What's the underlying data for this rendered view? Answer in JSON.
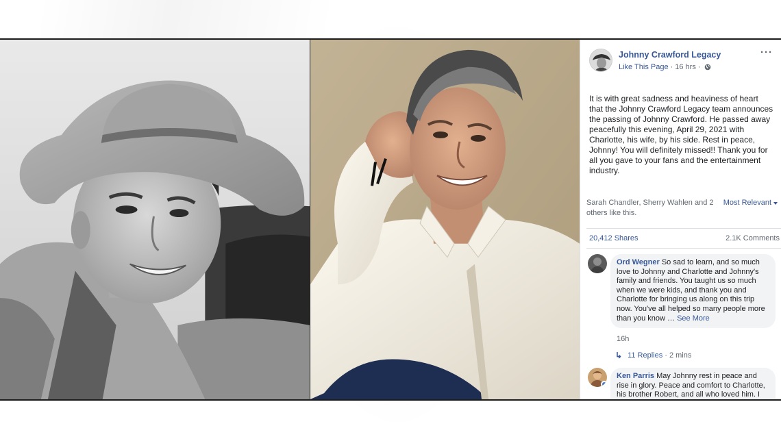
{
  "post": {
    "page_name": "Johnny Crawford Legacy",
    "like_link": "Like This Page",
    "separator": "·",
    "time": "16 hrs",
    "more_label": "···",
    "body": "It is with great sadness and heaviness of heart that the Johnny Crawford Legacy team announces the passing of Johnny Crawford. He passed away peacefully this evening, April 29, 2021 with Charlotte, his wife, by his side. Rest in peace, Johnny! You will definitely missed!! Thank you for all you gave to your fans and the entertainment industry."
  },
  "engagement": {
    "likes_text": "Sarah Chandler, Sherry Wahlen and 2 others like this.",
    "sort_label": "Most Relevant",
    "shares": "20,412 Shares",
    "comments": "2.1K Comments"
  },
  "comments": [
    {
      "author": "Ord Wegner",
      "text": "So sad to learn, and so much love to Johnny and Charlotte and Johnny's family and friends. You taught us so much when we were kids, and thank you and Charlotte for bringing us along on this trip now. You've all helped so many people more than you know …",
      "see_more": "See More",
      "time": "16h",
      "replies": "11 Replies",
      "replies_time": "· 2 mins"
    },
    {
      "author": "Ken Parris",
      "text": "May Johnny rest in peace and rise in glory. Peace and comfort to Charlotte, his brother Robert, and all who loved him. I am truly saddened by this"
    }
  ],
  "colors": {
    "link": "#385898",
    "meta": "#606770",
    "bubble": "#f2f3f5",
    "text": "#1c1e21"
  }
}
